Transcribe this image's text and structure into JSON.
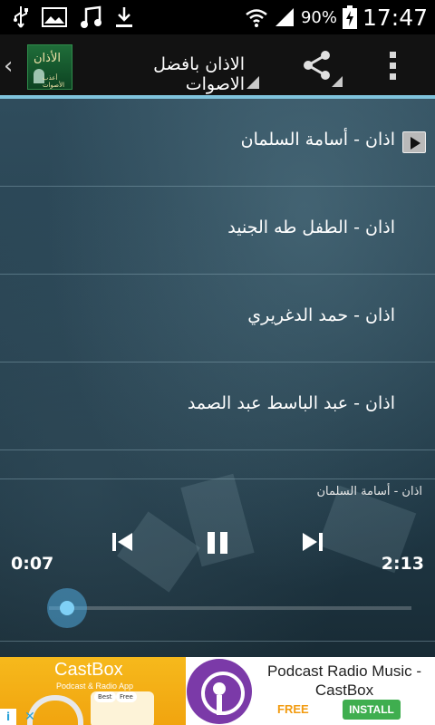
{
  "status_bar": {
    "battery_percent": "90%",
    "time": "17:47",
    "left_icons": [
      "usb-icon",
      "image-icon",
      "music-note-icon",
      "download-icon"
    ],
    "right_icons": [
      "wifi-icon",
      "signal-icon",
      "battery-charging-icon"
    ]
  },
  "action_bar": {
    "title": "الاذان بافضل الاصوات",
    "logo_text": "الأذان",
    "logo_subtext": "أعذب الأصوات",
    "accent_color": "#7fc3dc"
  },
  "playlist": {
    "items": [
      {
        "label": "اذان - أسامة السلمان",
        "playing": true
      },
      {
        "label": "اذان - الطفل طه الجنيد",
        "playing": false
      },
      {
        "label": "اذان - حمد الدغريري",
        "playing": false
      },
      {
        "label": "اذان - عبد الباسط عبد الصمد",
        "playing": false
      }
    ]
  },
  "player": {
    "now_playing": "اذان - أسامة السلمان",
    "elapsed": "0:07",
    "total": "2:13",
    "progress_fraction": 0.05
  },
  "ad": {
    "brand": "CastBox",
    "brand_sub": "Podcast & Radio App",
    "chip_best": "Best",
    "chip_free": "Free",
    "title": "Podcast Radio Music - CastBox",
    "price": "FREE",
    "install_label": "INSTALL",
    "info_symbol": "i",
    "close_symbol": "✕"
  }
}
